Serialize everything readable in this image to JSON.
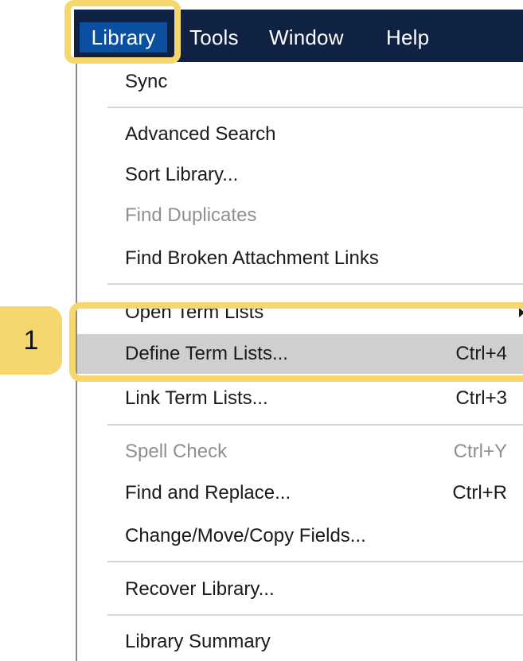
{
  "menubar": {
    "items": [
      {
        "label": "Library"
      },
      {
        "label": "Tools"
      },
      {
        "label": "Window"
      },
      {
        "label": "Help"
      }
    ]
  },
  "library_menu": {
    "items": [
      {
        "label": "Sync",
        "shortcut": "",
        "enabled": true
      },
      {
        "label": "Advanced Search",
        "shortcut": "",
        "enabled": true
      },
      {
        "label": "Sort Library...",
        "shortcut": "",
        "enabled": true
      },
      {
        "label": "Find Duplicates",
        "shortcut": "",
        "enabled": false
      },
      {
        "label": "Find Broken Attachment Links",
        "shortcut": "",
        "enabled": true
      },
      {
        "label": "Open Term Lists",
        "shortcut": "",
        "enabled": true,
        "submenu": true
      },
      {
        "label": "Define Term Lists...",
        "shortcut": "Ctrl+4",
        "enabled": true,
        "highlighted": true
      },
      {
        "label": "Link Term Lists...",
        "shortcut": "Ctrl+3",
        "enabled": true
      },
      {
        "label": "Spell Check",
        "shortcut": "Ctrl+Y",
        "enabled": false
      },
      {
        "label": "Find and Replace...",
        "shortcut": "Ctrl+R",
        "enabled": true
      },
      {
        "label": "Change/Move/Copy Fields...",
        "shortcut": "",
        "enabled": true
      },
      {
        "label": "Recover Library...",
        "shortcut": "",
        "enabled": true
      },
      {
        "label": "Library Summary",
        "shortcut": "",
        "enabled": true
      }
    ]
  },
  "callout": {
    "step_number": "1",
    "color": "#f5d76e"
  },
  "colors": {
    "menubar_bg": "#0f2244",
    "menubar_active": "#0b50a0",
    "item_highlight": "#cfcfcf",
    "disabled_text": "#8f8f8f"
  }
}
